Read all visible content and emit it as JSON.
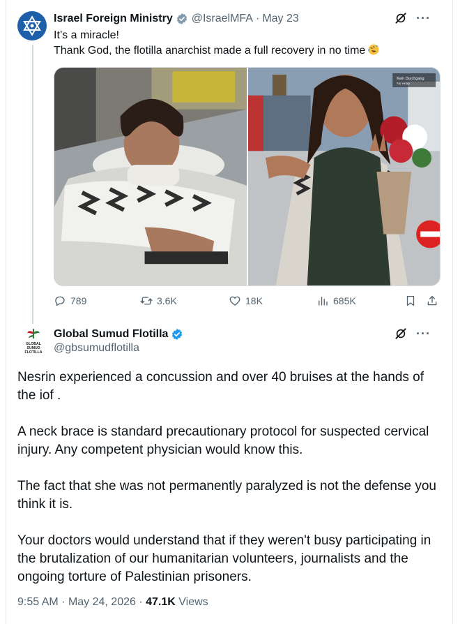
{
  "parent_tweet": {
    "author_name": "Israel Foreign Ministry",
    "handle": "@IsraelMFA",
    "separator": "·",
    "date": "May 23",
    "text_line1": "It’s a miracle!",
    "text_line2": "Thank God, the flotilla anarchist made a full recovery in no time",
    "emoji": "rolling-on-floor-laughing",
    "image_caption_sign": "Kein Durchgang",
    "image_caption_sign2": "No entry",
    "stats": {
      "replies": "789",
      "reposts": "3.6K",
      "likes": "18K",
      "views": "685K"
    },
    "icons": [
      "verified-gray-badge",
      "grok-icon",
      "more-icon",
      "reply-icon",
      "repost-icon",
      "like-icon",
      "views-icon",
      "bookmark-icon",
      "share-icon"
    ]
  },
  "reply_tweet": {
    "author_name": "Global Sumud Flotilla",
    "handle": "@gbsumudflotilla",
    "avatar_text": [
      "GLOBAL",
      "SUMUD",
      "FLOTILLA"
    ],
    "paragraphs": [
      "Nesrin experienced a concussion and over 40 bruises at the hands of the iof .",
      "A neck brace is standard precautionary protocol for suspected cervical injury. Any competent physician would know this.",
      "The fact that she was not permanently paralyzed is not the defense you think it is.",
      "Your doctors would understand that if they weren't busy participating in the brutalization of our humanitarian volunteers, journalists and the ongoing torture of Palestinian prisoners."
    ],
    "time": "9:55 AM",
    "separator": "·",
    "date": "May 24, 2026",
    "views_count": "47.1K",
    "views_label": "Views"
  },
  "colors": {
    "text_primary": "#0f1419",
    "text_secondary": "#536471",
    "verified_blue": "#1d9bf0",
    "verified_gray": "#829aab",
    "mfa_blue": "#1d5fa8"
  }
}
